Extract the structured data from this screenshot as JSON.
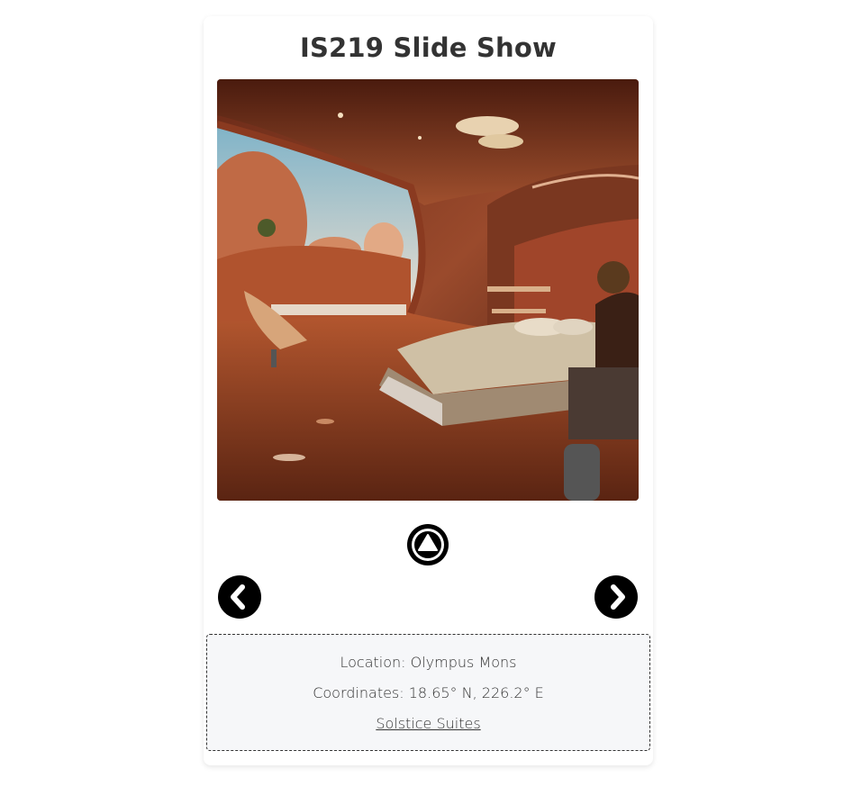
{
  "slideshow": {
    "title": "IS219 Slide Show",
    "image_alt": "Martian hotel suite interior with a bed and a large window overlooking red canyons"
  },
  "controls": {
    "toggle_icon": "circle-triangle-icon",
    "prev_icon": "chevron-left-circle-icon",
    "next_icon": "chevron-right-circle-icon"
  },
  "info": {
    "location": "Location: Olympus Mons",
    "coordinates": "Coordinates: 18.65° N, 226.2° E",
    "link_text": "Solstice Suites"
  },
  "colors": {
    "title": "#333333",
    "button": "#000000",
    "info_bg": "#f6f7f9"
  }
}
